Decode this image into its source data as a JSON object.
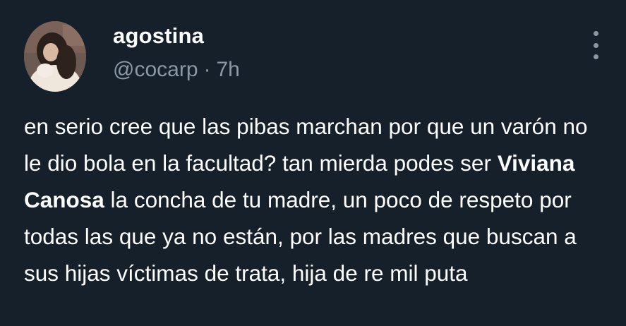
{
  "tweet": {
    "author": {
      "display_name": "agostina",
      "handle": "@cocarp",
      "separator": "·",
      "time": "7h",
      "avatar_icon": "profile-photo-avatar"
    },
    "more_icon": "vertical-ellipsis-icon",
    "text": {
      "part1": "en serio cree que las pibas marchan por que un varón no le dio bola en la facultad? tan mierda podes ser ",
      "mention": "Viviana Canosa",
      "part2": " la concha de tu madre, un poco de respeto por todas las que ya no están, por las madres que buscan a sus hijas víctimas de trata, hija de re mil puta"
    }
  },
  "colors": {
    "background": "#15202b",
    "primary_text": "#ffffff",
    "secondary_text": "#8b98a5"
  }
}
